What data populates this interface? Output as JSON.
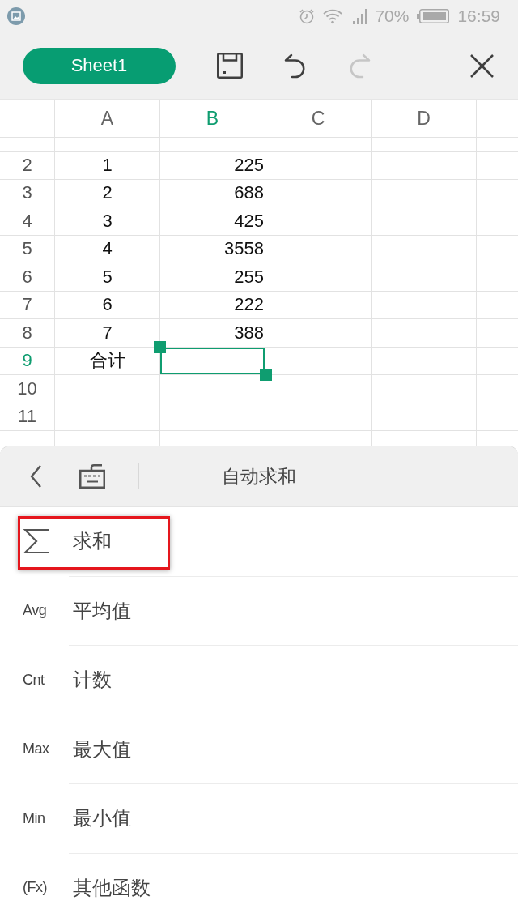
{
  "status_bar": {
    "battery": "70%",
    "time": "16:59"
  },
  "toolbar": {
    "sheet_tab": {
      "label": "Sheet1",
      "selected": true
    },
    "buttons": [
      {
        "kind": "save",
        "disabled": false
      },
      {
        "kind": "undo",
        "disabled": false
      },
      {
        "kind": "redo",
        "disabled": true
      },
      {
        "kind": "close",
        "disabled": false
      }
    ]
  },
  "sheet": {
    "columns": [
      {
        "label": "A",
        "selected": false
      },
      {
        "label": "B",
        "selected": true
      },
      {
        "label": "C",
        "selected": false
      },
      {
        "label": "D",
        "selected": false
      }
    ],
    "rows": [
      {
        "number": "2",
        "kind": "data",
        "selected": false,
        "cells": [
          "1",
          "225"
        ]
      },
      {
        "number": "3",
        "kind": "data",
        "selected": false,
        "cells": [
          "2",
          "688"
        ]
      },
      {
        "number": "4",
        "kind": "data",
        "selected": false,
        "cells": [
          "3",
          "425"
        ]
      },
      {
        "number": "5",
        "kind": "data",
        "selected": false,
        "cells": [
          "4",
          "3558"
        ]
      },
      {
        "number": "6",
        "kind": "data",
        "selected": false,
        "cells": [
          "5",
          "255"
        ]
      },
      {
        "number": "7",
        "kind": "data",
        "selected": false,
        "cells": [
          "6",
          "222"
        ]
      },
      {
        "number": "8",
        "kind": "data",
        "selected": false,
        "cells": [
          "7",
          "388"
        ]
      },
      {
        "number": "9",
        "kind": "data",
        "selected": true,
        "cells": [
          "合计"
        ]
      },
      {
        "number": "10",
        "kind": "data",
        "selected": false
      },
      {
        "number": "11",
        "kind": "data",
        "selected": false
      }
    ]
  },
  "bottom_panel": {
    "title": "自动求和",
    "functions": [
      {
        "kind": "sigma",
        "label": "求和",
        "highlighted": true
      },
      {
        "kind": "abbrev",
        "abbr": "Avg",
        "label": "平均值",
        "highlighted": false
      },
      {
        "kind": "abbrev",
        "abbr": "Cnt",
        "label": "计数",
        "highlighted": false
      },
      {
        "kind": "abbrev",
        "abbr": "Max",
        "label": "最大值",
        "highlighted": false
      },
      {
        "kind": "abbrev",
        "abbr": "Min",
        "label": "最小值",
        "highlighted": false
      },
      {
        "kind": "abbrev",
        "abbr": "(Fx)",
        "label": "其他函数",
        "highlighted": false
      }
    ]
  }
}
